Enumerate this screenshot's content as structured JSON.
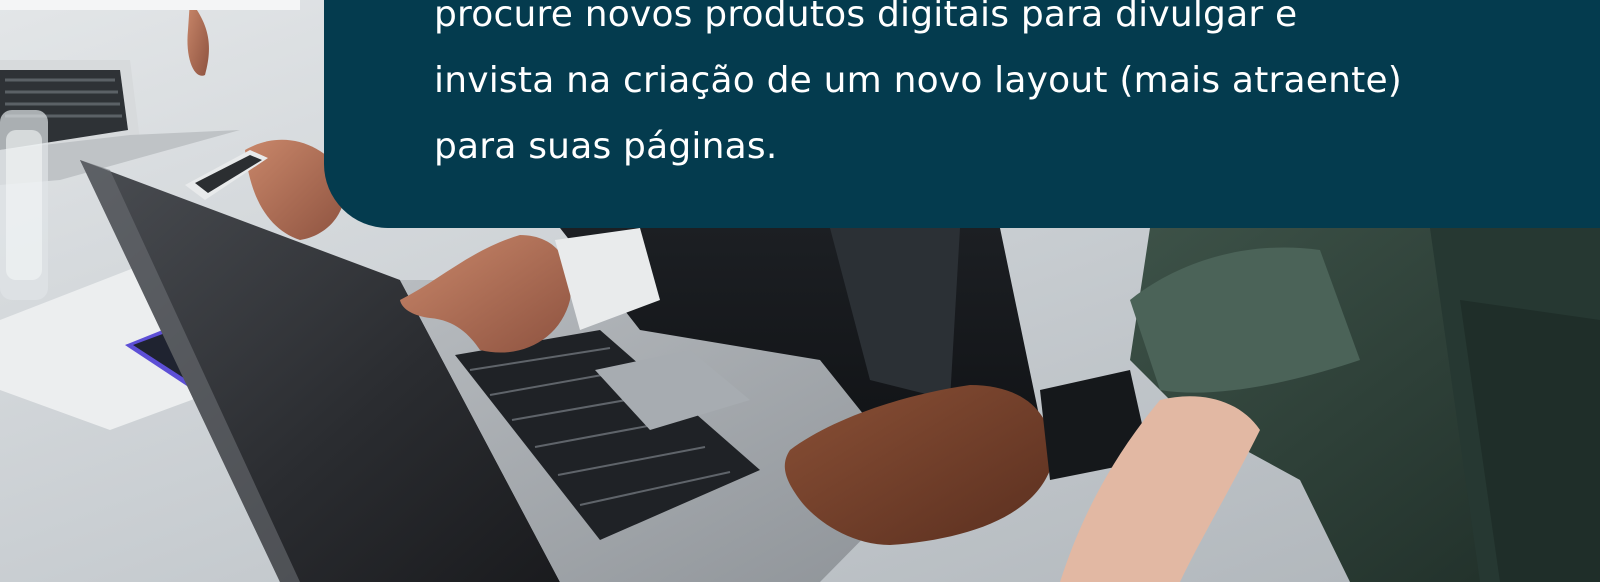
{
  "callout": {
    "lines": [
      "procure novos produtos digitais para divulgar e",
      "invista na criação de um novo layout (mais atraente)",
      "para suas páginas."
    ]
  },
  "colors": {
    "callout_background": "#043b4e",
    "callout_text": "#ffffff"
  }
}
